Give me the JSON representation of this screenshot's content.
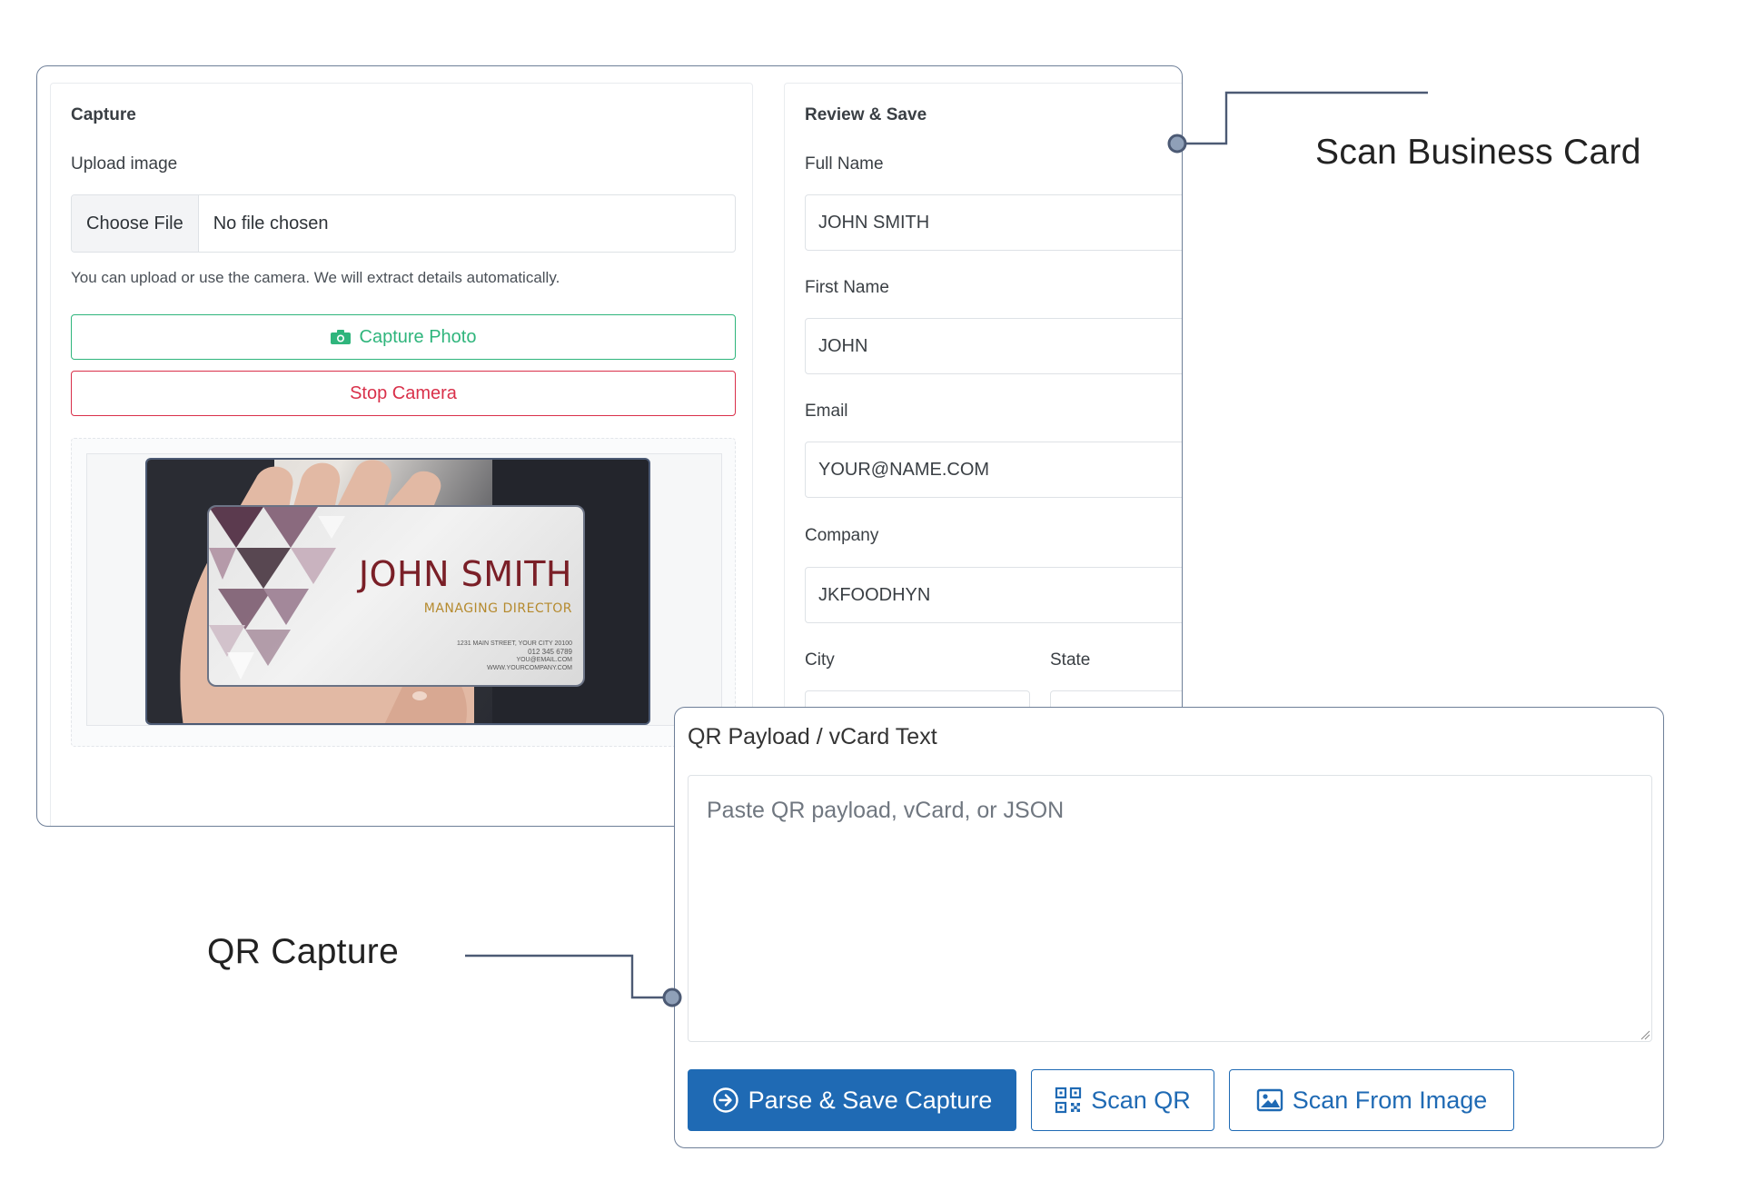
{
  "capture": {
    "title": "Capture",
    "upload_label": "Upload image",
    "choose_file": "Choose File",
    "file_status": "No file chosen",
    "help_text": "You can upload or use the camera. We will extract details automatically.",
    "capture_photo": "Capture Photo",
    "stop_camera": "Stop Camera"
  },
  "business_card": {
    "name": "JOHN SMITH",
    "title": "MANAGING DIRECTOR",
    "address": "1231 MAIN STREET, YOUR CITY 20100",
    "phone": "012 345 6789",
    "email": "YOU@EMAIL.COM",
    "website": "WWW.YOURCOMPANY.COM"
  },
  "review": {
    "title": "Review & Save",
    "full_name_label": "Full Name",
    "full_name": "JOHN SMITH",
    "first_name_label": "First Name",
    "first_name": "JOHN",
    "email_label": "Email",
    "email": "YOUR@NAME.COM",
    "company_label": "Company",
    "company": "JKFOODHYN",
    "city_label": "City",
    "state_label": "State"
  },
  "qr": {
    "title": "QR Payload / vCard Text",
    "placeholder": "Paste QR payload, vCard, or JSON",
    "parse_save": "Parse & Save Capture",
    "scan_qr": "Scan QR",
    "scan_image": "Scan From Image"
  },
  "callouts": {
    "scan_business_card": "Scan Business Card",
    "qr_capture": "QR Capture"
  },
  "colors": {
    "primary": "#1f6ab4",
    "success": "#2fb57c",
    "danger": "#d9304a",
    "frame": "#6e7f98"
  }
}
